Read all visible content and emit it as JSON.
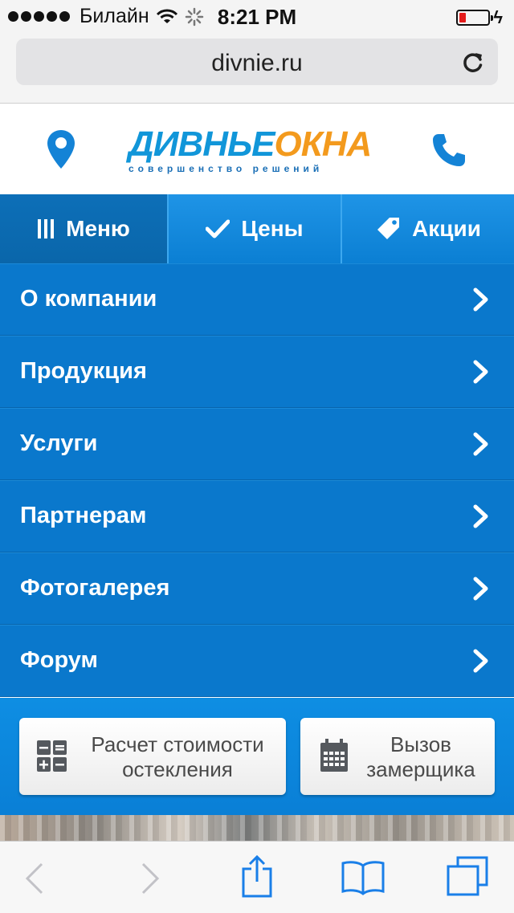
{
  "status_bar": {
    "carrier": "Билайн",
    "time": "8:21 PM",
    "battery_color": "#e31b1b"
  },
  "browser": {
    "url": "divnie.ru",
    "reload_icon": "reload-icon"
  },
  "header": {
    "logo_part1": "ДИВНЬЕ",
    "logo_part2": "ОКНА",
    "logo_tagline": "совершенство решений",
    "location_icon": "map-pin-icon",
    "phone_icon": "phone-icon",
    "brand_blue": "#1196d9",
    "brand_orange": "#f39a1d"
  },
  "tabs": [
    {
      "label": "Меню",
      "icon": "menu-bars-icon"
    },
    {
      "label": "Цены",
      "icon": "checkmark-icon"
    },
    {
      "label": "Акции",
      "icon": "tag-icon"
    }
  ],
  "menu": {
    "items": [
      {
        "label": "О компании"
      },
      {
        "label": "Продукция"
      },
      {
        "label": "Услуги"
      },
      {
        "label": "Партнерам"
      },
      {
        "label": "Фотогалерея"
      },
      {
        "label": "Форум"
      }
    ],
    "background": "#0a78cc"
  },
  "actions": {
    "calc_line1": "Расчет стоимости",
    "calc_line2": "остекления",
    "measure_line1": "Вызов",
    "measure_line2": "замерщика"
  },
  "toolbar": {
    "icons": [
      "back-icon",
      "forward-icon",
      "share-icon",
      "bookmarks-icon",
      "tabs-icon"
    ],
    "accent": "#1a7fe8"
  }
}
